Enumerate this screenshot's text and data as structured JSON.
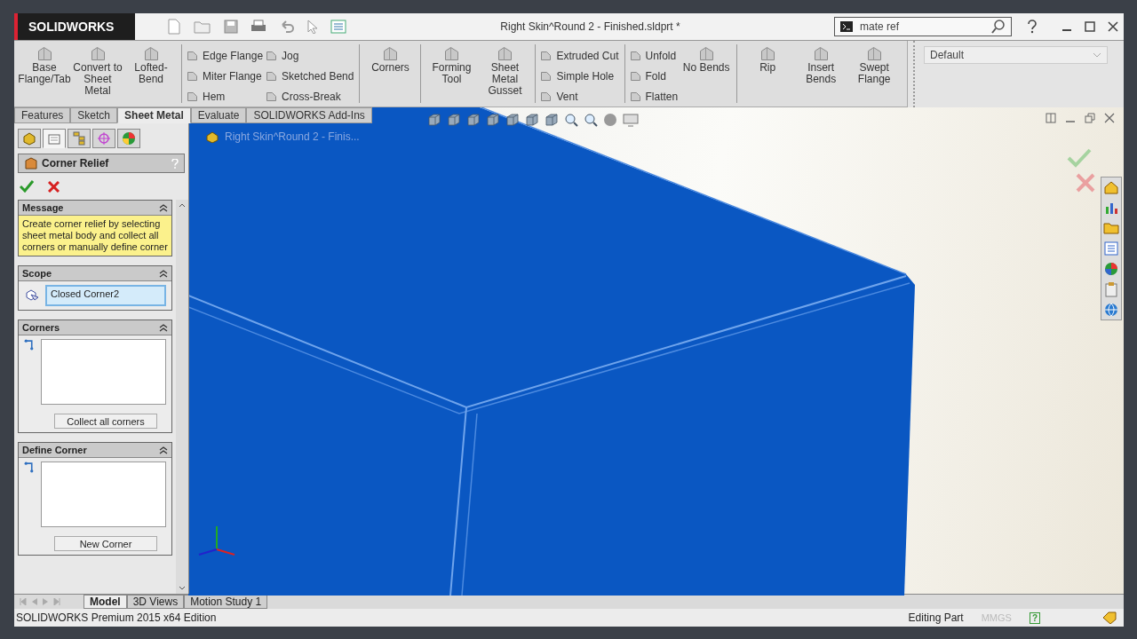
{
  "app": {
    "logo": "SOLIDWORKS",
    "title": "Right Skin^Round 2 - Finished.sldprt *",
    "search": {
      "value": "mate ref"
    }
  },
  "ribbon": {
    "groups": [
      {
        "items": [
          {
            "kind": "large",
            "label": "Base Flange/Tab"
          },
          {
            "kind": "large",
            "label": "Convert to Sheet Metal"
          },
          {
            "kind": "large",
            "label": "Lofted-Bend"
          }
        ]
      },
      {
        "items": [
          {
            "kind": "small",
            "label": "Edge Flange"
          },
          {
            "kind": "small",
            "label": "Miter Flange"
          },
          {
            "kind": "small",
            "label": "Hem"
          },
          {
            "kind": "small",
            "label": "Jog"
          },
          {
            "kind": "small",
            "label": "Sketched Bend"
          },
          {
            "kind": "small",
            "label": "Cross-Break"
          }
        ]
      },
      {
        "items": [
          {
            "kind": "large",
            "label": "Corners"
          }
        ]
      },
      {
        "items": [
          {
            "kind": "large",
            "label": "Forming Tool"
          },
          {
            "kind": "large",
            "label": "Sheet Metal Gusset"
          }
        ]
      },
      {
        "items": [
          {
            "kind": "small",
            "label": "Extruded Cut"
          },
          {
            "kind": "small",
            "label": "Simple Hole"
          },
          {
            "kind": "small",
            "label": "Vent"
          }
        ]
      },
      {
        "items": [
          {
            "kind": "small",
            "label": "Unfold"
          },
          {
            "kind": "small",
            "label": "Fold"
          },
          {
            "kind": "small",
            "label": "Flatten"
          },
          {
            "kind": "large",
            "label": "No Bends"
          }
        ]
      },
      {
        "items": [
          {
            "kind": "large",
            "label": "Rip"
          },
          {
            "kind": "large",
            "label": "Insert Bends"
          },
          {
            "kind": "large",
            "label": "Swept Flange"
          }
        ]
      }
    ],
    "configuration": "Default"
  },
  "command_tabs": [
    {
      "label": "Features",
      "selected": false
    },
    {
      "label": "Sketch",
      "selected": false
    },
    {
      "label": "Sheet Metal",
      "selected": true
    },
    {
      "label": "Evaluate",
      "selected": false
    },
    {
      "label": "SOLIDWORKS Add-Ins",
      "selected": false
    }
  ],
  "panel_tabs": [
    {
      "selected": false
    },
    {
      "selected": true
    },
    {
      "selected": false
    },
    {
      "selected": false
    },
    {
      "selected": false
    }
  ],
  "property_manager": {
    "title": "Corner Relief",
    "sections": [
      {
        "kind": "message",
        "title": "Message",
        "text": "Create corner relief by selecting sheet metal body and collect all corners or manually define corner"
      },
      {
        "kind": "field",
        "title": "Scope",
        "value": "Closed Corner2"
      },
      {
        "kind": "list",
        "title": "Corners",
        "button": "Collect all corners"
      },
      {
        "kind": "list",
        "title": "Define Corner",
        "button": "New Corner"
      }
    ]
  },
  "tree": {
    "label": "Right Skin^Round 2 - Finis..."
  },
  "bottom_tabs": [
    {
      "label": "Model",
      "selected": true
    },
    {
      "label": "3D Views",
      "selected": false
    },
    {
      "label": "Motion Study 1",
      "selected": false
    }
  ],
  "status_bar": {
    "edition": "SOLIDWORKS Premium 2015 x64 Edition",
    "mode": "Editing Part",
    "units": "MMGS",
    "help": "?"
  }
}
